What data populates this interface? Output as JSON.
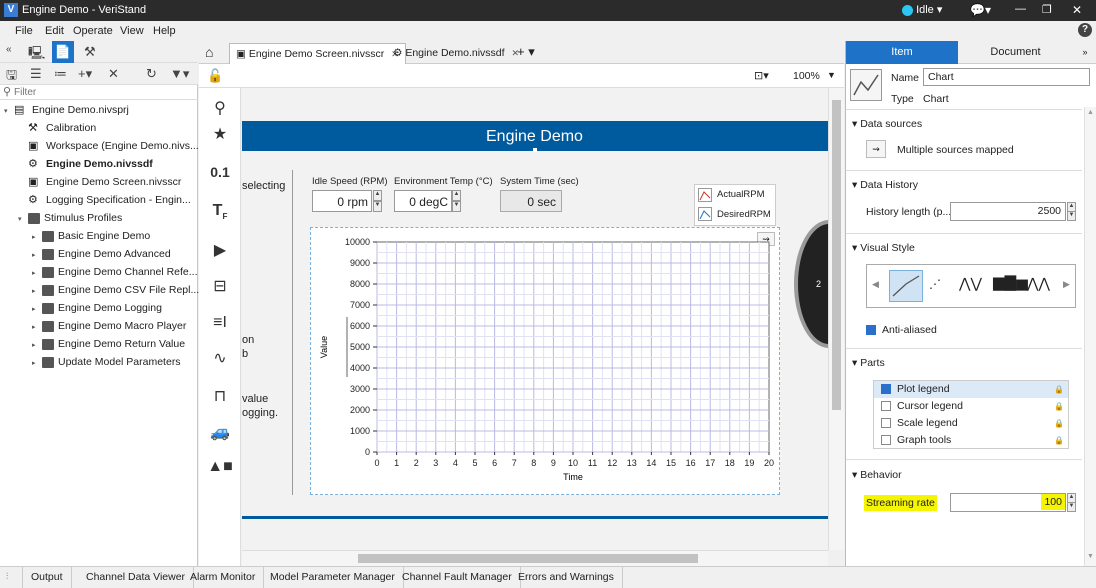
{
  "window": {
    "title": "Engine Demo - VeriStand",
    "status": "Idle"
  },
  "menu": [
    "File",
    "Edit",
    "Operate",
    "View",
    "Help"
  ],
  "left_panel": {
    "filter_placeholder": "Filter",
    "tree": [
      {
        "label": "Engine Demo.nivsprj",
        "indent": 0,
        "bold": false,
        "kind": "project"
      },
      {
        "label": "Calibration",
        "indent": 1,
        "bold": false,
        "kind": "tool"
      },
      {
        "label": "Workspace (Engine Demo.nivs...",
        "indent": 1,
        "bold": false,
        "kind": "file"
      },
      {
        "label": "Engine Demo.nivssdf",
        "indent": 1,
        "bold": true,
        "kind": "sdf"
      },
      {
        "label": "Engine Demo Screen.nivsscr",
        "indent": 1,
        "bold": false,
        "kind": "file"
      },
      {
        "label": "Logging Specification - Engin...",
        "indent": 1,
        "bold": false,
        "kind": "gear"
      },
      {
        "label": "Stimulus Profiles",
        "indent": 1,
        "bold": false,
        "kind": "folder",
        "expanded": true
      },
      {
        "label": "Basic Engine Demo",
        "indent": 2,
        "bold": false,
        "kind": "folder"
      },
      {
        "label": "Engine Demo Advanced",
        "indent": 2,
        "bold": false,
        "kind": "folder"
      },
      {
        "label": "Engine Demo Channel Refe...",
        "indent": 2,
        "bold": false,
        "kind": "folder"
      },
      {
        "label": "Engine Demo CSV File Repl...",
        "indent": 2,
        "bold": false,
        "kind": "folder"
      },
      {
        "label": "Engine Demo Logging",
        "indent": 2,
        "bold": false,
        "kind": "folder"
      },
      {
        "label": "Engine Demo Macro Player",
        "indent": 2,
        "bold": false,
        "kind": "folder"
      },
      {
        "label": "Engine Demo Return Value",
        "indent": 2,
        "bold": false,
        "kind": "folder"
      },
      {
        "label": "Update Model Parameters",
        "indent": 2,
        "bold": false,
        "kind": "folder"
      }
    ]
  },
  "tabs": [
    {
      "label": "Engine Demo Screen.nivsscr",
      "active": true
    },
    {
      "label": "Engine Demo.nivssdf",
      "active": false
    }
  ],
  "canvas_toolbar": {
    "zoom": "100%"
  },
  "palette": {
    "numeric_label": "0.1"
  },
  "screen": {
    "banner_title": "Engine Demo",
    "left_text_1": "selecting",
    "left_text_2": "on",
    "left_text_3": "b",
    "left_text_4": "value",
    "left_text_5": "ogging.",
    "controls": [
      {
        "label": "Idle Speed (RPM)",
        "value": "0 rpm"
      },
      {
        "label": "Environment Temp (°C)",
        "value": "0 degC"
      },
      {
        "label": "System Time (sec)",
        "value": "0 sec"
      }
    ],
    "legend": [
      "ActualRPM",
      "DesiredRPM"
    ],
    "gauge_tick": "2"
  },
  "chart_data": {
    "type": "line",
    "xlabel": "Time",
    "ylabel": "Value",
    "xlim": [
      0,
      20
    ],
    "ylim": [
      0,
      10000
    ],
    "x_ticks": [
      0,
      1,
      2,
      3,
      4,
      5,
      6,
      7,
      8,
      9,
      10,
      11,
      12,
      13,
      14,
      15,
      16,
      17,
      18,
      19,
      20
    ],
    "y_ticks": [
      0,
      1000,
      2000,
      3000,
      4000,
      5000,
      6000,
      7000,
      8000,
      9000,
      10000
    ],
    "grid": true,
    "series": [
      {
        "name": "ActualRPM",
        "values": []
      },
      {
        "name": "DesiredRPM",
        "values": []
      }
    ],
    "legend_position": "top-right"
  },
  "right_panel": {
    "tabs": [
      "Item",
      "Document"
    ],
    "active_tab": "Item",
    "name_label": "Name",
    "name_value": "Chart",
    "type_label": "Type",
    "type_value": "Chart",
    "sections": {
      "data_sources": {
        "title": "Data sources",
        "value": "Multiple sources mapped"
      },
      "data_history": {
        "title": "Data History",
        "field_label": "History length (p...",
        "field_value": "2500"
      },
      "visual_style": {
        "title": "Visual Style",
        "anti_aliased_label": "Anti-aliased",
        "anti_aliased": true
      },
      "parts": {
        "title": "Parts",
        "items": [
          {
            "label": "Plot legend",
            "checked": true
          },
          {
            "label": "Cursor legend",
            "checked": false
          },
          {
            "label": "Scale legend",
            "checked": false
          },
          {
            "label": "Graph tools",
            "checked": false
          }
        ]
      },
      "behavior": {
        "title": "Behavior",
        "field_label": "Streaming rate",
        "field_value": "100"
      }
    }
  },
  "bottom_tabs": [
    "Output",
    "Channel Data Viewer",
    "Alarm Monitor",
    "Model Parameter Manager",
    "Channel Fault Manager",
    "Errors and Warnings"
  ],
  "colors": {
    "banner": "#005a9e",
    "accent": "#1e73c8",
    "highlight": "#f5f500"
  }
}
